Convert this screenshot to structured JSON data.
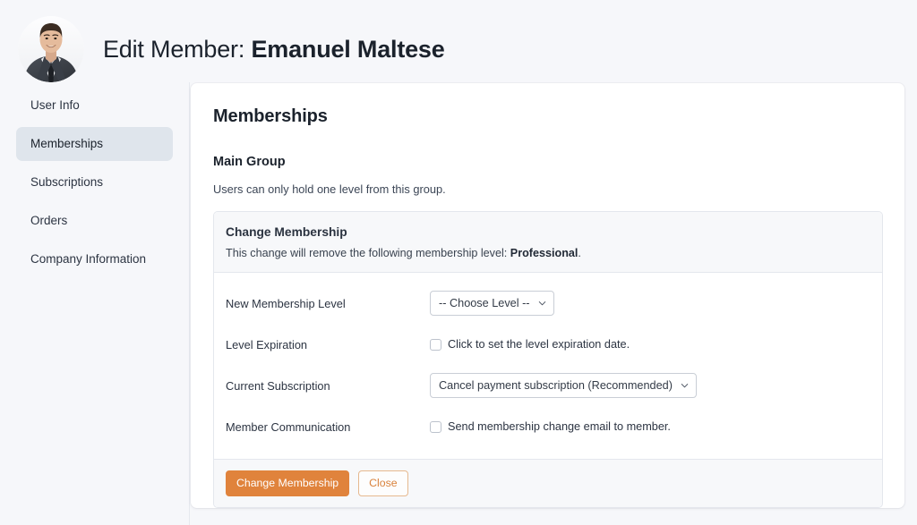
{
  "header": {
    "title_prefix": "Edit Member:",
    "member_name": "Emanuel Maltese",
    "avatar_alt": "member-photo"
  },
  "sidebar": {
    "items": [
      {
        "label": "User Info",
        "active": false
      },
      {
        "label": "Memberships",
        "active": true
      },
      {
        "label": "Subscriptions",
        "active": false
      },
      {
        "label": "Orders",
        "active": false
      },
      {
        "label": "Company Information",
        "active": false
      }
    ]
  },
  "main": {
    "card_title": "Memberships",
    "group_title": "Main Group",
    "group_description": "Users can only hold one level from this group.",
    "panel": {
      "heading": "Change Membership",
      "notice_prefix": "This change will remove the following membership level:",
      "notice_level": "Professional",
      "notice_suffix": ".",
      "rows": {
        "new_level": {
          "label": "New Membership Level",
          "selected": "-- Choose Level --",
          "options": [
            "-- Choose Level --"
          ]
        },
        "level_expiration": {
          "label": "Level Expiration",
          "checkbox_label": "Click to set the level expiration date.",
          "checked": false
        },
        "current_subscription": {
          "label": "Current Subscription",
          "selected": "Cancel payment subscription (Recommended)",
          "options": [
            "Cancel payment subscription (Recommended)"
          ]
        },
        "member_communication": {
          "label": "Member Communication",
          "checkbox_label": "Send membership change email to member.",
          "checked": false
        }
      },
      "footer": {
        "primary_label": "Change Membership",
        "secondary_label": "Close"
      }
    }
  },
  "colors": {
    "page_background": "#f6f7fa",
    "accent_orange": "#e0833c",
    "active_nav": "#dfe5ec",
    "panel_header": "#f7f8fa",
    "text_primary": "#1b222c"
  }
}
